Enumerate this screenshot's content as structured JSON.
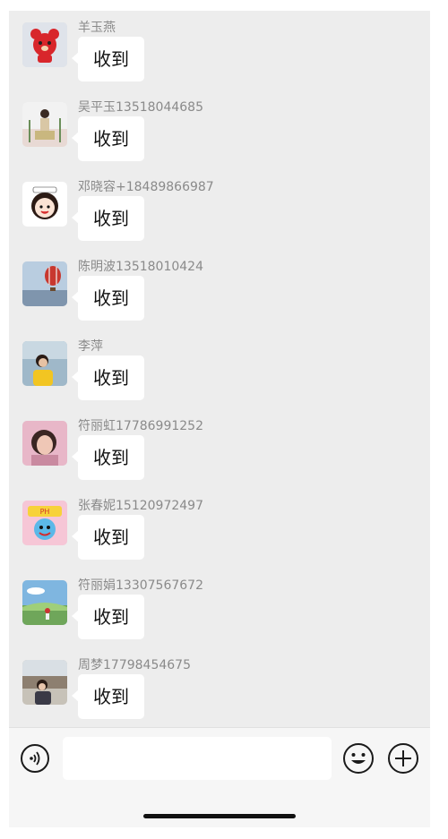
{
  "messages": [
    {
      "sender": "羊玉燕",
      "text": "收到",
      "avatar": "red-bear-avatar"
    },
    {
      "sender": "吴平玉13518044685",
      "text": "收到",
      "avatar": "woman-photo-avatar"
    },
    {
      "sender": "邓晓容+18489866987",
      "text": "收到",
      "avatar": "cartoon-girl-avatar"
    },
    {
      "sender": "陈明波13518010424",
      "text": "收到",
      "avatar": "hot-air-balloon-avatar"
    },
    {
      "sender": "李萍",
      "text": "收到",
      "avatar": "woman-yellow-avatar"
    },
    {
      "sender": "符丽虹17786991252",
      "text": "收到",
      "avatar": "woman-portrait-avatar"
    },
    {
      "sender": "张春妮15120972497",
      "text": "收到",
      "avatar": "cartoon-sticker-avatar"
    },
    {
      "sender": "符丽娟13307567672",
      "text": "收到",
      "avatar": "landscape-avatar"
    },
    {
      "sender": "周梦17798454675",
      "text": "收到",
      "avatar": "woman-outdoor-avatar"
    }
  ],
  "input_bar": {
    "text_value": "",
    "voice_icon": "voice-icon",
    "emoji_icon": "emoji-icon",
    "plus_icon": "plus-icon"
  },
  "colors": {
    "chat_background": "#ededed",
    "bubble": "#ffffff",
    "sender_text": "#8a8a8a"
  }
}
